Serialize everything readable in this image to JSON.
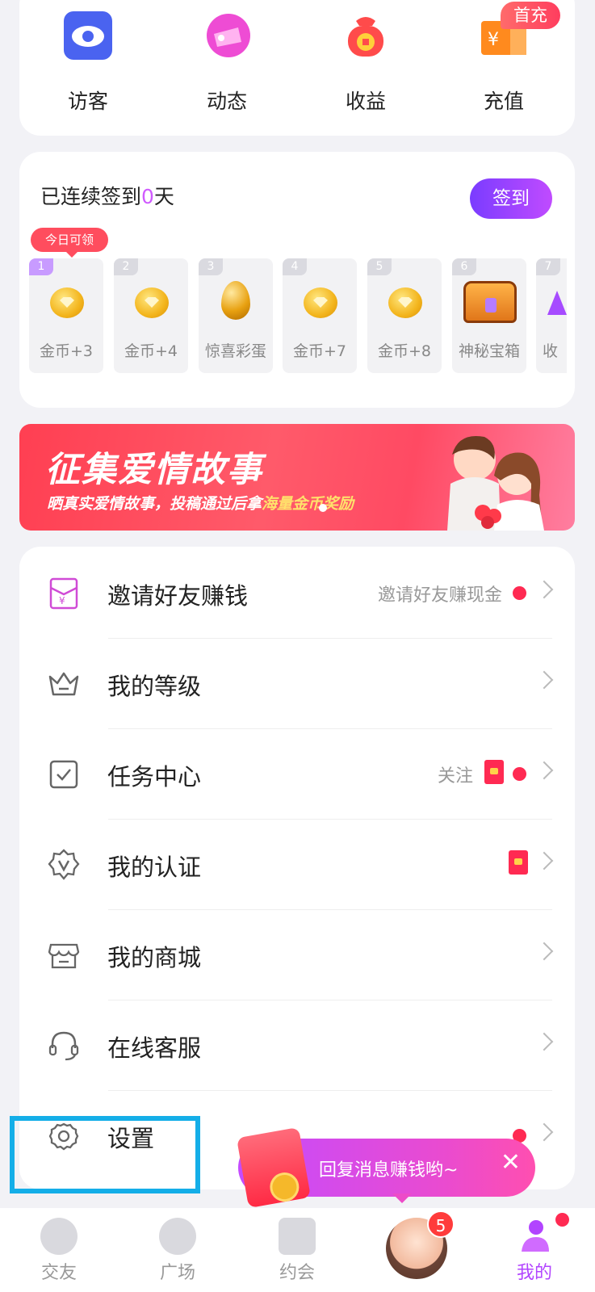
{
  "quick_actions": [
    {
      "label": "访客",
      "icon": "eye-icon"
    },
    {
      "label": "动态",
      "icon": "moments-icon"
    },
    {
      "label": "收益",
      "icon": "money-bag-icon"
    },
    {
      "label": "充值",
      "icon": "recharge-icon"
    }
  ],
  "first_recharge_badge": "首充",
  "checkin": {
    "title_prefix": "已连续签到",
    "days_count": "0",
    "title_suffix": "天",
    "sign_button": "签到",
    "today_tag": "今日可领",
    "days": [
      {
        "num": "1",
        "label": "金币+3",
        "icon": "gold-coin-icon"
      },
      {
        "num": "2",
        "label": "金币+4",
        "icon": "gold-coin-icon"
      },
      {
        "num": "3",
        "label": "惊喜彩蛋",
        "icon": "golden-egg-icon"
      },
      {
        "num": "4",
        "label": "金币+7",
        "icon": "gold-coin-icon"
      },
      {
        "num": "5",
        "label": "金币+8",
        "icon": "gold-coin-icon"
      },
      {
        "num": "6",
        "label": "神秘宝箱",
        "icon": "treasure-chest-icon"
      },
      {
        "num": "7",
        "label": "收",
        "icon": "gift-icon"
      }
    ]
  },
  "banner": {
    "title": "征集爱情故事",
    "subtitle_prefix": "晒真实爱情故事，投稿通过后拿",
    "subtitle_highlight": "海量金币奖励"
  },
  "menu": [
    {
      "label": "邀请好友赚钱",
      "icon": "invite-envelope-icon",
      "sub": "邀请好友赚现金",
      "red_dot": true
    },
    {
      "label": "我的等级",
      "icon": "crown-icon"
    },
    {
      "label": "任务中心",
      "icon": "task-check-icon",
      "sub": "关注",
      "envelope": true,
      "red_dot": true
    },
    {
      "label": "我的认证",
      "icon": "verified-badge-icon",
      "envelope": true
    },
    {
      "label": "我的商城",
      "icon": "store-icon"
    },
    {
      "label": "在线客服",
      "icon": "headset-icon"
    },
    {
      "label": "设置",
      "icon": "gear-icon",
      "red_dot": true
    }
  ],
  "toast": {
    "label": "回复消息赚钱哟~",
    "close": "✕"
  },
  "bottom_nav": [
    {
      "label": "交友",
      "icon": "friends-icon"
    },
    {
      "label": "广场",
      "icon": "plaza-icon"
    },
    {
      "label": "约会",
      "icon": "video-date-icon"
    },
    {
      "label": "",
      "icon": "avatar",
      "badge": "5"
    },
    {
      "label": "我的",
      "icon": "profile-icon"
    }
  ],
  "colors": {
    "accent": "#b244ff",
    "red": "#ff2a52",
    "highlight_box": "#14aee8"
  }
}
